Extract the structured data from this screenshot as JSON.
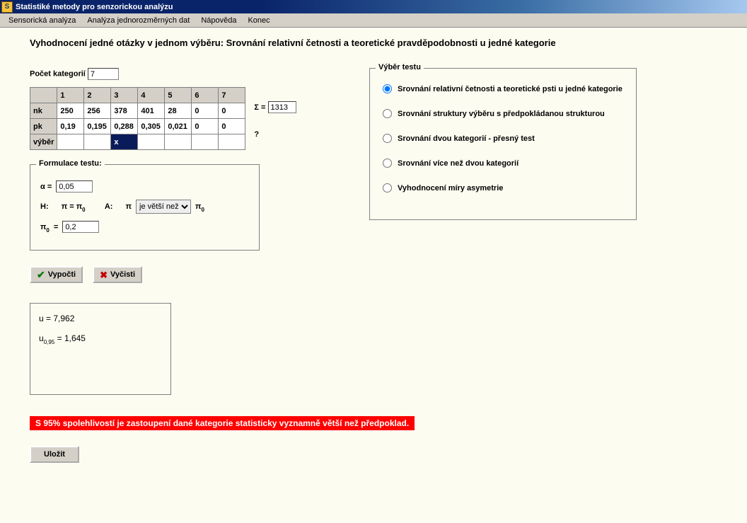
{
  "window": {
    "title": "Statistiké metody pro senzorickou analýzu"
  },
  "menu": {
    "items": [
      "Sensorická analýza",
      "Analýza jednorozměrných dat",
      "Nápověda",
      "Konec"
    ]
  },
  "page_title": "Vyhodnocení jedné otázky v jednom výběru:  Srovnání relativní četnosti a teoretické pravděpodobnosti u jedné kategorie",
  "categories": {
    "label": "Počet kategorií",
    "value": "7"
  },
  "table": {
    "headers": [
      "1",
      "2",
      "3",
      "4",
      "5",
      "6",
      "7"
    ],
    "rows": {
      "nk": {
        "label": "nk",
        "values": [
          "250",
          "256",
          "378",
          "401",
          "28",
          "0",
          "0"
        ]
      },
      "pk": {
        "label": "pk",
        "values": [
          "0,19",
          "0,195",
          "0,288",
          "0,305",
          "0,021",
          "0",
          "0"
        ]
      },
      "vyber": {
        "label": "výběr",
        "values": [
          "",
          "",
          "x",
          "",
          "",
          "",
          ""
        ],
        "selected_index": 2
      }
    },
    "sigma_label": "Σ =",
    "sigma_value": "1313",
    "question_mark": "?"
  },
  "formulation": {
    "legend": "Formulace testu:",
    "alpha_label": "α  =",
    "alpha_value": "0,05",
    "H_label": "H:",
    "H_expr": "π = π",
    "A_label": "A:",
    "A_pi": "π",
    "compare_options": [
      "je větší než"
    ],
    "compare_selected": "je větší než",
    "pi0_suffix": "π",
    "pi0_label": "π",
    "pi0_eq": "=",
    "pi0_value": "0,2",
    "sub0": "0"
  },
  "buttons": {
    "compute": "Vypočti",
    "clear": "Vyčisti",
    "save": "Uložit"
  },
  "results": {
    "u_line": "u = 7,962",
    "ucrit_prefix": "u",
    "ucrit_sub": "0,95",
    "ucrit_rest": " = 1,645"
  },
  "conclusion": "S 95% spolehlivostí je zastoupení dané kategorie statisticky vyznamně větší než předpoklad.",
  "test_select": {
    "legend": "Výběr testu",
    "options": [
      "Srovnání relativní četnosti a teoretické psti u jedné kategorie",
      "Srovnání struktury výběru s předpokládanou strukturou",
      "Srovnání dvou kategorií - přesný test",
      "Srovnání více než dvou kategorií",
      "Vyhodnocení míry asymetrie"
    ],
    "selected_index": 0
  }
}
